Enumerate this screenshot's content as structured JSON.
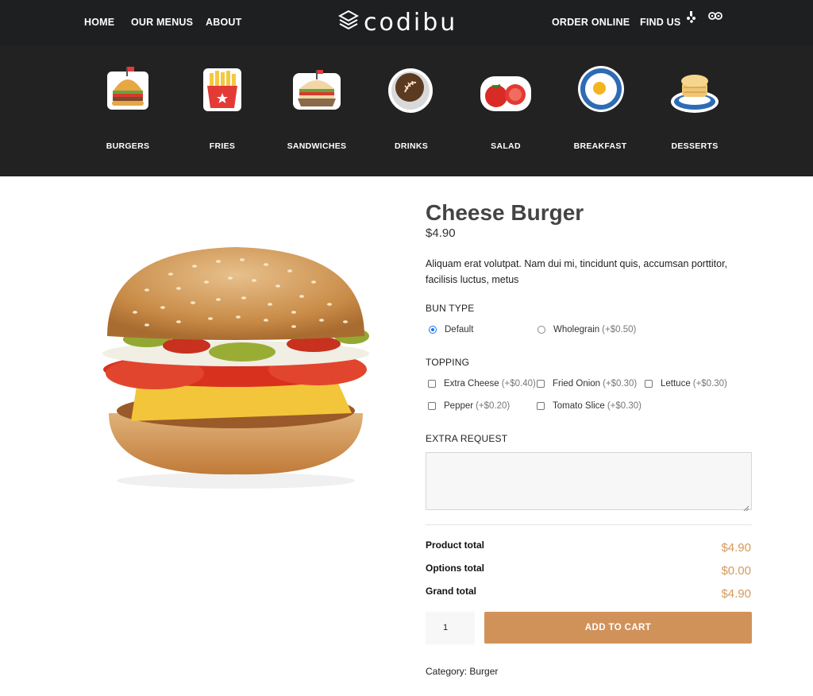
{
  "nav": {
    "home": "HOME",
    "menus": "OUR MENUS",
    "about": "ABOUT",
    "order": "ORDER ONLINE",
    "find": "FIND US"
  },
  "brand": {
    "logo_text": "codibu",
    "logo_icon": "stacked-layers-icon"
  },
  "social": [
    "yelp-icon",
    "tripadvisor-icon"
  ],
  "categories": [
    {
      "label": "BURGERS",
      "icon": "burger-icon"
    },
    {
      "label": "FRIES",
      "icon": "fries-icon"
    },
    {
      "label": "SANDWICHES",
      "icon": "sandwich-icon"
    },
    {
      "label": "DRINKS",
      "icon": "coffee-icon"
    },
    {
      "label": "SALAD",
      "icon": "tomato-icon"
    },
    {
      "label": "BREAKFAST",
      "icon": "fried-egg-icon"
    },
    {
      "label": "DESSERTS",
      "icon": "pancakes-icon"
    }
  ],
  "product": {
    "title": "Cheese Burger",
    "price": "$4.90",
    "description": "Aliquam erat volutpat. Nam dui mi, tincidunt quis, accumsan porttitor, facilisis luctus, metus",
    "image": "cheeseburger-photo"
  },
  "bun_type": {
    "label": "BUN TYPE",
    "options": [
      {
        "name": "Default",
        "extra": "",
        "selected": true
      },
      {
        "name": "Wholegrain",
        "extra": "(+$0.50)",
        "selected": false
      }
    ]
  },
  "topping": {
    "label": "TOPPING",
    "options": [
      {
        "name": "Extra Cheese",
        "extra": "(+$0.40)"
      },
      {
        "name": "Fried Onion",
        "extra": "(+$0.30)"
      },
      {
        "name": "Lettuce",
        "extra": "(+$0.30)"
      },
      {
        "name": "Pepper",
        "extra": "(+$0.20)"
      },
      {
        "name": "Tomato Slice",
        "extra": "(+$0.30)"
      }
    ]
  },
  "extra_request": {
    "label": "EXTRA REQUEST",
    "value": ""
  },
  "totals": {
    "product_label": "Product total",
    "product_value": "$4.90",
    "options_label": "Options total",
    "options_value": "$0.00",
    "grand_label": "Grand total",
    "grand_value": "$4.90"
  },
  "cart": {
    "quantity": "1",
    "button": "ADD TO CART"
  },
  "meta": {
    "category_label": "Category:",
    "category_value": "Burger"
  },
  "colors": {
    "header_bg": "#222222",
    "accent": "#d1925a",
    "price_accent": "#d39a5c"
  }
}
